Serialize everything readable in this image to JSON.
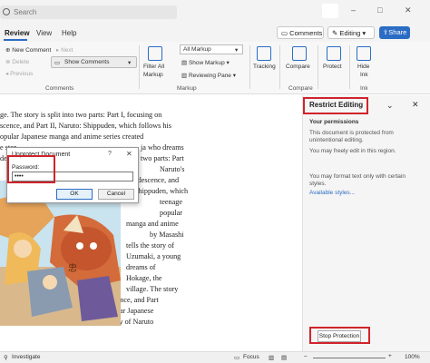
{
  "titlebar": {
    "search_placeholder": "Search",
    "minimize": "–",
    "maximize": "□",
    "close": "✕"
  },
  "tabs": {
    "review": "Review",
    "view": "View",
    "help": "Help"
  },
  "header_buttons": {
    "comments": "Comments",
    "editing": "Editing",
    "share": "Share"
  },
  "ribbon": {
    "new_comment": "New Comment",
    "delete": "Delete",
    "previous": "Previous",
    "next": "Next",
    "show_comments": "Show Comments",
    "comments_group": "Comments",
    "filter_all_markup": "Filter All",
    "filter_all_markup_2": "Markup",
    "all_markup": "All Markup",
    "show_markup": "Show Markup",
    "reviewing_pane": "Reviewing Pane",
    "markup_group": "Markup",
    "tracking": "Tracking",
    "compare": "Compare",
    "compare_group": "Compare",
    "protect": "Protect",
    "hide_ink": "Hide",
    "hide_ink_2": "Ink",
    "ink_group": "Ink"
  },
  "document": {
    "lines": [
      "ge. The story is split into two parts: Part I, focusing on",
      "scence, and Part II, Naruto: Shippuden, which follows his",
      "opular Japanese manga and anime series created",
      "e stor",
      "der o"
    ],
    "right_col": [
      "ja who dreams",
      "two parts: Part",
      "Naruto's",
      "adescence, and",
      "Shippuden, which",
      "teenage",
      "popular",
      "manga and anime",
      "by Masashi",
      "tells the story of",
      "Uzumaki, a young",
      "dreams of",
      "Hokage, the",
      "village. The story"
    ],
    "bottom_lines": [
      "sing on Naruto's childhood and adolescence, and Part",
      "ows his teenage years. Naruto is a popular Japanese",
      "d by Masashi Kishimoto. It tells the story of Naruto"
    ]
  },
  "dialog": {
    "title": "Unprotect Document",
    "help": "?",
    "close": "✕",
    "password_label": "Password:",
    "password_value": "••••",
    "ok": "OK",
    "cancel": "Cancel"
  },
  "pane": {
    "title": "Restrict Editing",
    "your_permissions": "Your permissions",
    "protected_1": "This document is protected from",
    "protected_2": "unintentional editing.",
    "freely_edit": "You may freely edit in this region.",
    "format_1": "You may format text only with certain",
    "format_2": "styles.",
    "available_styles": "Available styles...",
    "stop_protection": "Stop Protection"
  },
  "statusbar": {
    "investigate": "Investigate",
    "focus": "Focus",
    "zoom": "100%"
  },
  "colors": {
    "accent": "#2b6cc4",
    "highlight": "#d0242b"
  }
}
